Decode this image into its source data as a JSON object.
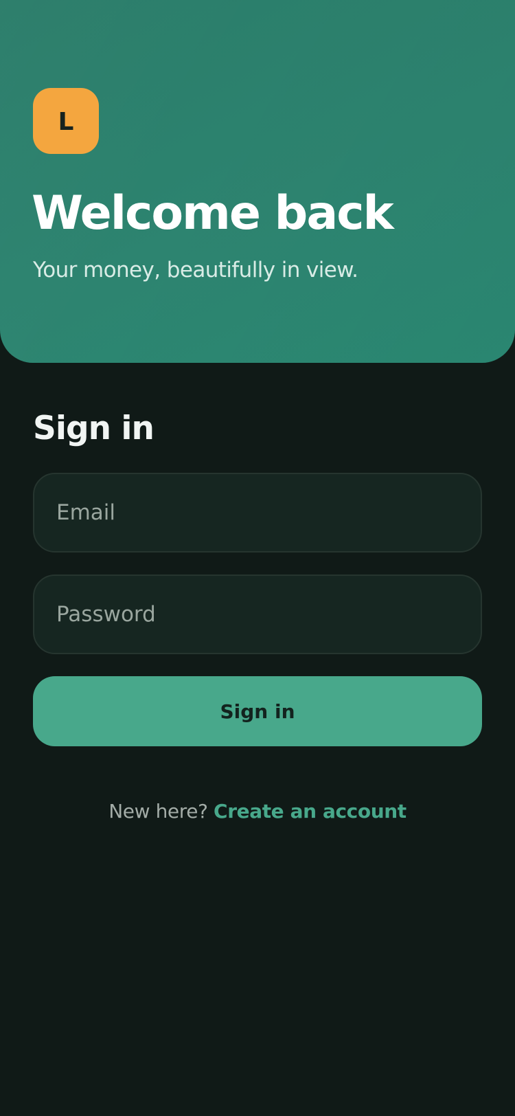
{
  "hero": {
    "logo_letter": "L",
    "title": "Welcome back",
    "subtitle": "Your money, beautifully in view."
  },
  "form": {
    "heading": "Sign in",
    "email": {
      "value": "",
      "placeholder": "Email"
    },
    "password": {
      "value": "",
      "placeholder": "Password"
    },
    "submit_label": "Sign in"
  },
  "footer": {
    "prompt": "New here? ",
    "link_label": "Create an account"
  },
  "colors": {
    "hero_background": "#2b8570",
    "page_background": "#101a17",
    "logo_badge": "#f4a63f",
    "accent": "#48a88b",
    "field_background": "#162621",
    "field_border": "#26352f"
  }
}
